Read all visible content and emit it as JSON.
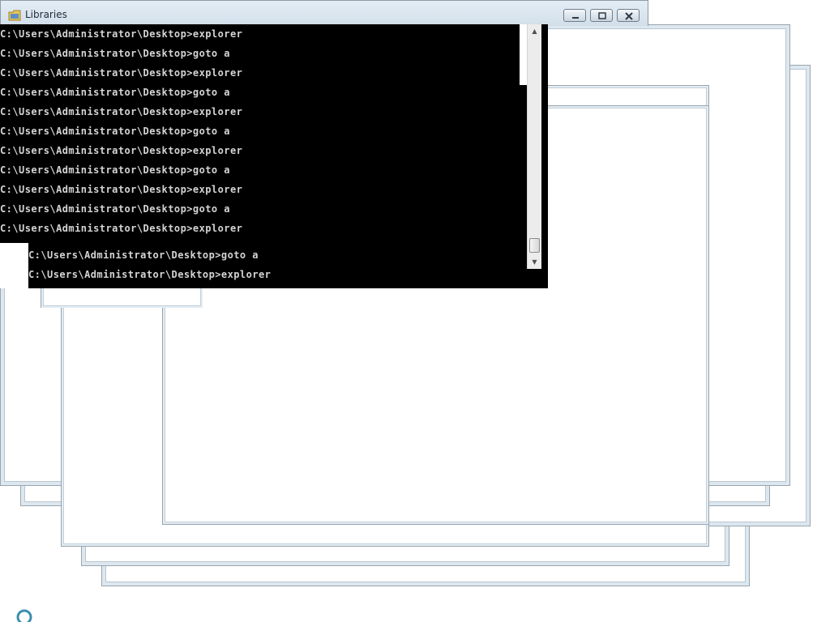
{
  "window": {
    "title": "Libraries",
    "controls": {
      "minimize": "minimize-icon",
      "maximize": "maximize-icon",
      "close": "close-icon"
    }
  },
  "console": {
    "lines": [
      "C:\\Users\\Administrator\\Desktop>explorer",
      "C:\\Users\\Administrator\\Desktop>goto a",
      "C:\\Users\\Administrator\\Desktop>explorer",
      "C:\\Users\\Administrator\\Desktop>goto a",
      "C:\\Users\\Administrator\\Desktop>explorer",
      "C:\\Users\\Administrator\\Desktop>goto a",
      "C:\\Users\\Administrator\\Desktop>explorer",
      "C:\\Users\\Administrator\\Desktop>goto a",
      "C:\\Users\\Administrator\\Desktop>explorer",
      "C:\\Users\\Administrator\\Desktop>goto a",
      "C:\\Users\\Administrator\\Desktop>explorer"
    ],
    "trailing_lines": [
      "C:\\Users\\Administrator\\Desktop>goto a",
      "C:\\Users\\Administrator\\Desktop>explorer"
    ]
  },
  "colors": {
    "console_bg": "#000000",
    "console_text": "#d4d4d4",
    "window_frame": "#dde7ef"
  },
  "icons": {
    "title": "folder-libraries-icon",
    "taskbar": "start-orb-icon"
  }
}
